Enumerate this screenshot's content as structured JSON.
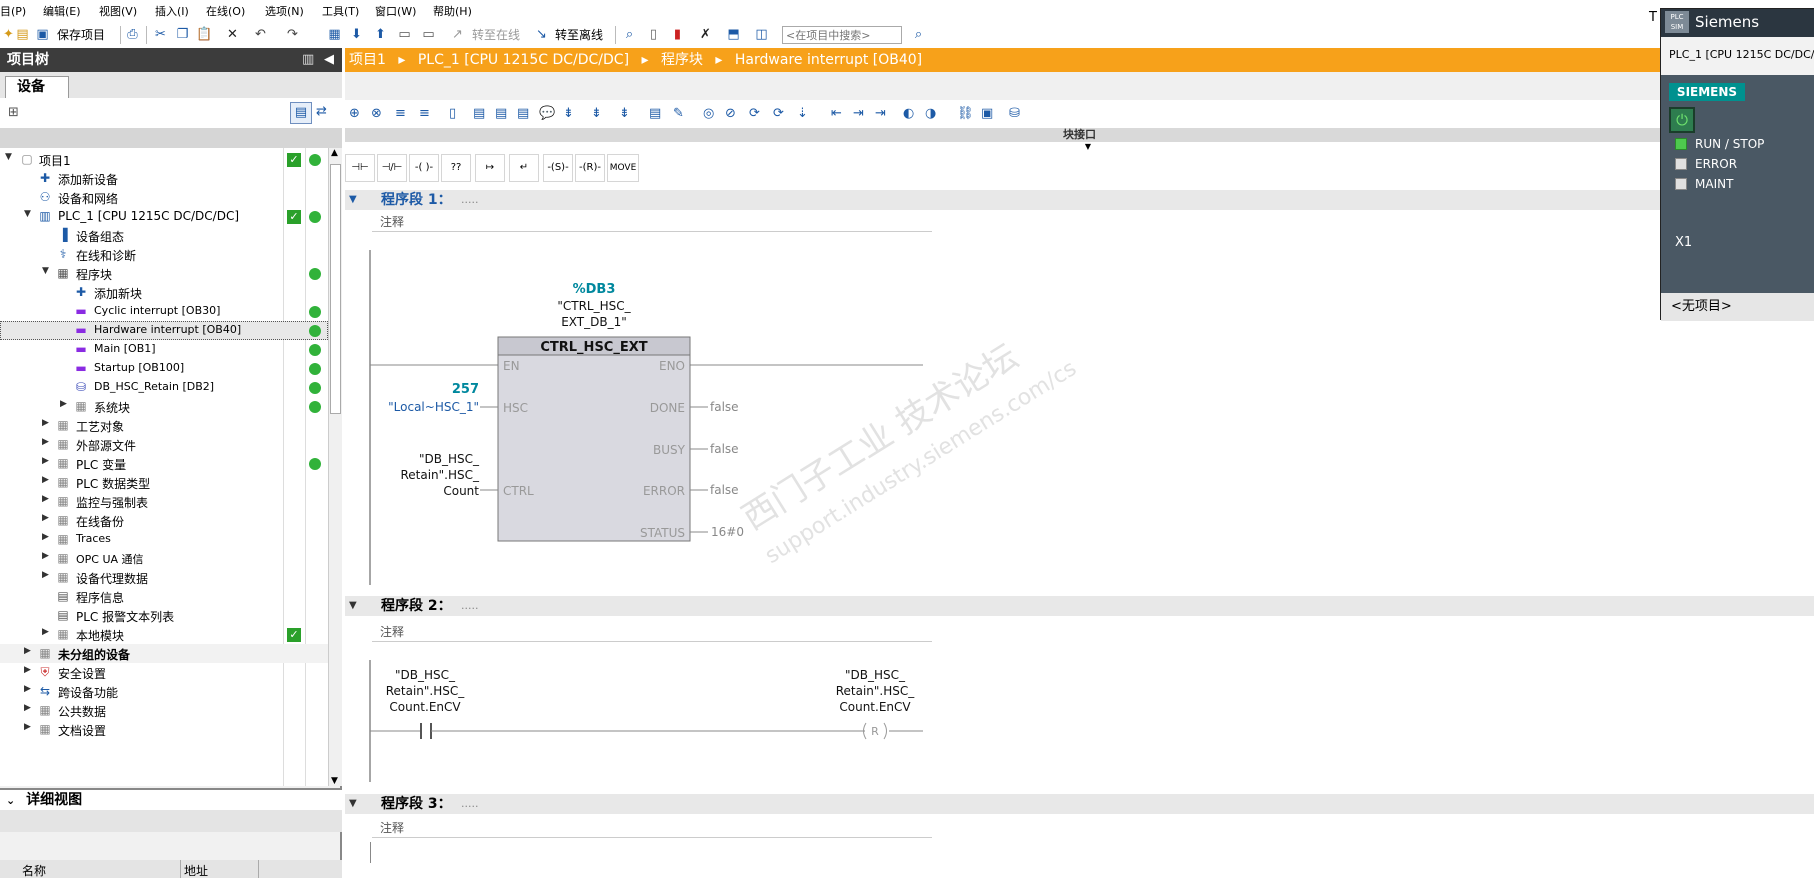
{
  "menu": [
    "目(P)",
    "编辑(E)",
    "视图(V)",
    "插入(I)",
    "在线(O)",
    "选项(N)",
    "工具(T)",
    "窗口(W)",
    "帮助(H)"
  ],
  "toolbar": {
    "save_label": "保存项目",
    "go_online": "转至在线",
    "go_offline": "转至离线",
    "search_placeholder": "<在项目中搜索>"
  },
  "project_tree": {
    "title": "项目树",
    "tab": "设备",
    "items": [
      "项目1",
      "添加新设备",
      "设备和网络",
      "PLC_1 [CPU 1215C DC/DC/DC]",
      "设备组态",
      "在线和诊断",
      "程序块",
      "添加新块",
      "Cyclic interrupt [OB30]",
      "Hardware interrupt [OB40]",
      "Main [OB1]",
      "Startup [OB100]",
      "DB_HSC_Retain [DB2]",
      "系统块",
      "工艺对象",
      "外部源文件",
      "PLC 变量",
      "PLC 数据类型",
      "监控与强制表",
      "在线备份",
      "Traces",
      "OPC UA 通信",
      "设备代理数据",
      "程序信息",
      "PLC 报警文本列表",
      "本地模块",
      "未分组的设备",
      "安全设置",
      "跨设备功能",
      "公共数据",
      "文档设置"
    ]
  },
  "detail_view": {
    "title": "详细视图",
    "col_name": "名称",
    "col_addr": "地址"
  },
  "breadcrumb": [
    "项目1",
    "PLC_1 [CPU 1215C DC/DC/DC]",
    "程序块",
    "Hardware interrupt [OB40]"
  ],
  "editor": {
    "block_interface": "块接口",
    "ladder_buttons": [
      "⊣⊢",
      "⊣/⊢",
      "-( )-",
      "??",
      "↦",
      "↵",
      "-(S)-",
      "-(R)-",
      "MOVE"
    ],
    "networks": [
      {
        "label": "程序段 1：",
        "dots": ".....",
        "comment": "注释"
      },
      {
        "label": "程序段 2：",
        "dots": ".....",
        "comment": "注释"
      },
      {
        "label": "程序段 3：",
        "dots": ".....",
        "comment": "注释"
      }
    ],
    "nw1": {
      "db_addr": "%DB3",
      "db_name_l1": "\"CTRL_HSC_",
      "db_name_l2": "EXT_DB_1\"",
      "box_title": "CTRL_HSC_EXT",
      "pin_en": "EN",
      "pin_eno": "ENO",
      "pin_hsc": "HSC",
      "pin_done": "DONE",
      "pin_busy": "BUSY",
      "pin_error": "ERROR",
      "pin_status": "STATUS",
      "pin_ctrl": "CTRL",
      "hsc_val": "257",
      "hsc_tag": "\"Local~HSC_1\"",
      "ctrl_l1": "\"DB_HSC_",
      "ctrl_l2": "Retain\".HSC_",
      "ctrl_l3": "Count",
      "done_val": "false",
      "busy_val": "false",
      "error_val": "false",
      "status_val": "16#0"
    },
    "nw2": {
      "contact_l1": "\"DB_HSC_",
      "contact_l2": "Retain\".HSC_",
      "contact_l3": "Count.EnCV",
      "coil_l1": "\"DB_HSC_",
      "coil_l2": "Retain\".HSC_",
      "coil_l3": "Count.EnCV",
      "coil_sym": "R"
    }
  },
  "watermark": {
    "line1": "西门子工业 技术论坛",
    "line2": "support.industry.siemens.com/cs"
  },
  "simulator": {
    "title": "Siemens",
    "logo_text": "PLC SIM",
    "device": "PLC_1 [CPU 1215C DC/DC/",
    "brand": "SIEMENS",
    "leds": [
      "RUN / STOP",
      "ERROR",
      "MAINT"
    ],
    "slot": "X1",
    "footer": "<无项目>"
  },
  "colors": {
    "accent": "#f7a11a",
    "teal": "#00889e",
    "green": "#31b23a"
  }
}
